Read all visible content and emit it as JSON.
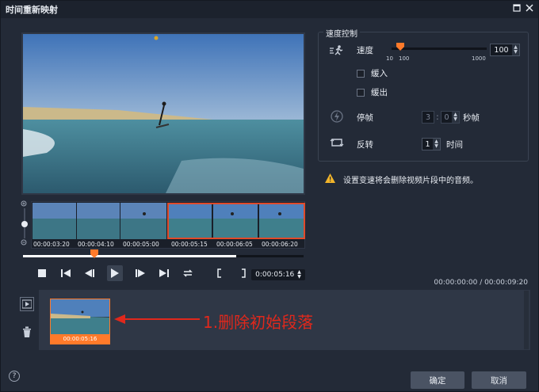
{
  "window": {
    "title": "时间重新映射",
    "maximize_icon": "maximize-icon",
    "close_icon": "close-icon"
  },
  "preview": {
    "description_icon": "video-frame"
  },
  "filmstrip": {
    "timecodes": [
      "00:00:03:20",
      "00:00:04:10",
      "00:00:05:00",
      "00:00:05:15",
      "00:00:06:05",
      "00:00:06:20"
    ]
  },
  "playback": {
    "timecode": "0:00:05:16",
    "progress_fraction": 0.76,
    "marker_fraction": 0.24
  },
  "duration_text": "00:00:00:00 / 00:00:09:20",
  "speed_group": {
    "title": "速度控制",
    "speed_label": "速度",
    "speed_value": "100",
    "slider_min": "10",
    "slider_mid": "100",
    "slider_max": "1000",
    "ease_in_label": "缓入",
    "ease_out_label": "缓出",
    "freeze_label": "停帧",
    "freeze_seconds": "3",
    "freeze_frames": "0",
    "freeze_unit": "秒帧",
    "reverse_label": "反转",
    "reverse_value": "1",
    "reverse_unit": "时间"
  },
  "warning_text": "设置变速将会删除视频片段中的音频。",
  "clip": {
    "timecode": "00:00:05:16"
  },
  "annotation": "1.删除初始段落",
  "buttons": {
    "ok": "确定",
    "cancel": "取消",
    "help": "?"
  },
  "colors": {
    "accent": "#ff7a2a",
    "annotation": "#e0281c",
    "bg": "#232a37"
  }
}
